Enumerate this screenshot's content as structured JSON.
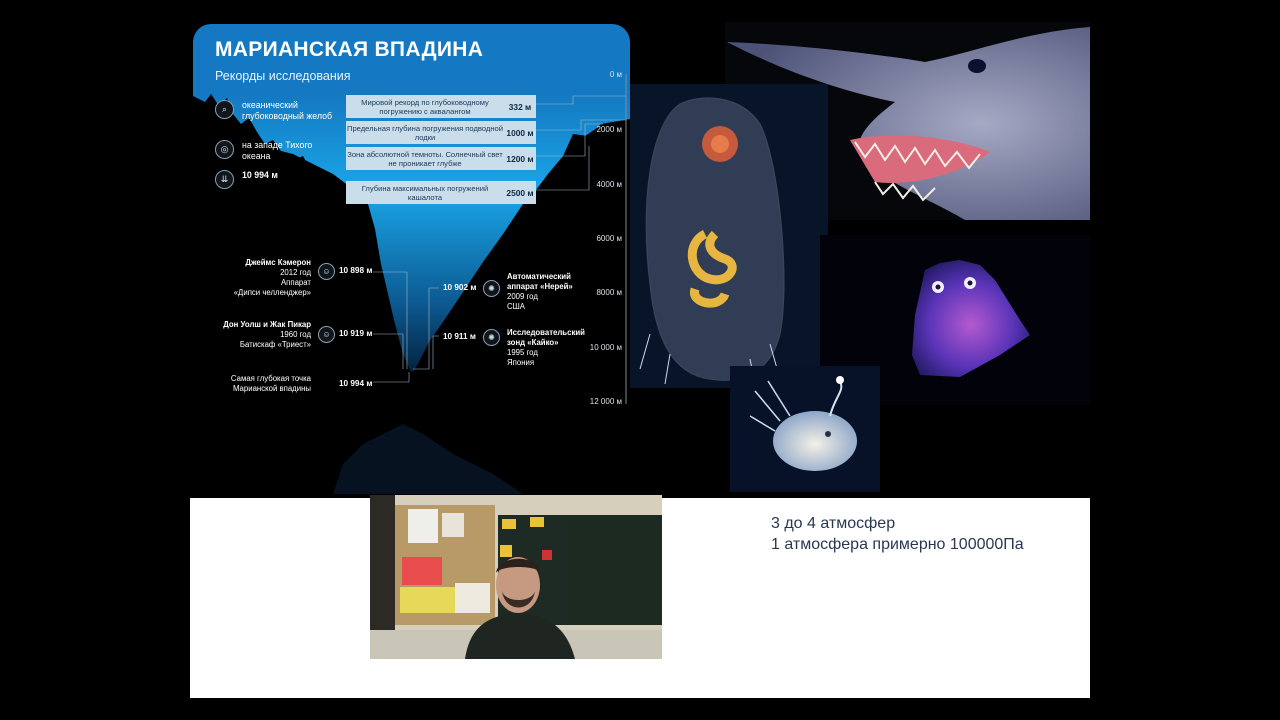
{
  "infographic": {
    "title": "МАРИАНСКАЯ ВПАДИНА",
    "subtitle": "Рекорды исследования",
    "facts": [
      {
        "icon": "magnifier-icon",
        "text": "океанический глубоководный желоб"
      },
      {
        "icon": "compass-icon",
        "text": "на западе Тихого океана"
      },
      {
        "icon": "depth-marker-icon",
        "text": "10 994 м"
      }
    ],
    "records": [
      {
        "text": "Мировой рекорд по глубоководному погружению с аквалангом",
        "value": "332 м"
      },
      {
        "text": "Предельная глубина погружения подводной лодки",
        "value": "1000 м"
      },
      {
        "text": "Зона абсолютной темноты. Солнечный свет не проникает глубже",
        "value": "1200 м"
      },
      {
        "text": "Глубина максимальных погружений кашалота",
        "value": "2500 м"
      }
    ],
    "depth_scale": [
      "0 м",
      "2000 м",
      "4000 м",
      "6000 м",
      "8000 м",
      "10 000 м",
      "12 000 м"
    ],
    "people": [
      {
        "name": "Джеймс Кэмерон",
        "line2": "2012 год",
        "line3": "Аппарат",
        "line4": "«Дипси челленджер»",
        "depth": "10 898 м"
      },
      {
        "name": "Дон Уолш и Жак Пикар",
        "line2": "1960 год",
        "line3": "Батискаф «Триест»",
        "line4": "",
        "depth": "10 919 м"
      },
      {
        "name": "",
        "line2": "Самая глубокая точка",
        "line3": "Марианской впадины",
        "line4": "",
        "depth": "10 994 м"
      }
    ],
    "apparatus": [
      {
        "depth": "10 902 м",
        "name1": "Автоматический",
        "name2": "аппарат «Нерей»",
        "year": "2009 год",
        "country": "США"
      },
      {
        "depth": "10 911 м",
        "name1": "Исследовательский",
        "name2": "зонд «Кайко»",
        "year": "1995 год",
        "country": "Япония"
      }
    ],
    "colors": {
      "ocean_top": "#1aa6e8",
      "ocean_deep": "#0a2c55",
      "title_band": "#1479c2"
    }
  },
  "photos": {
    "shark": "goblin-shark-photo",
    "jelly": "transparent-sea-cucumber-photo",
    "purple": "purple-deep-sea-creature-photo",
    "angler": "anglerfish-photo"
  },
  "webcam": {
    "label": "teacher-webcam-feed"
  },
  "notes": {
    "line1": "3 до 4 атмосфер",
    "line2": "1 атмосфера примерно 100000Па"
  }
}
